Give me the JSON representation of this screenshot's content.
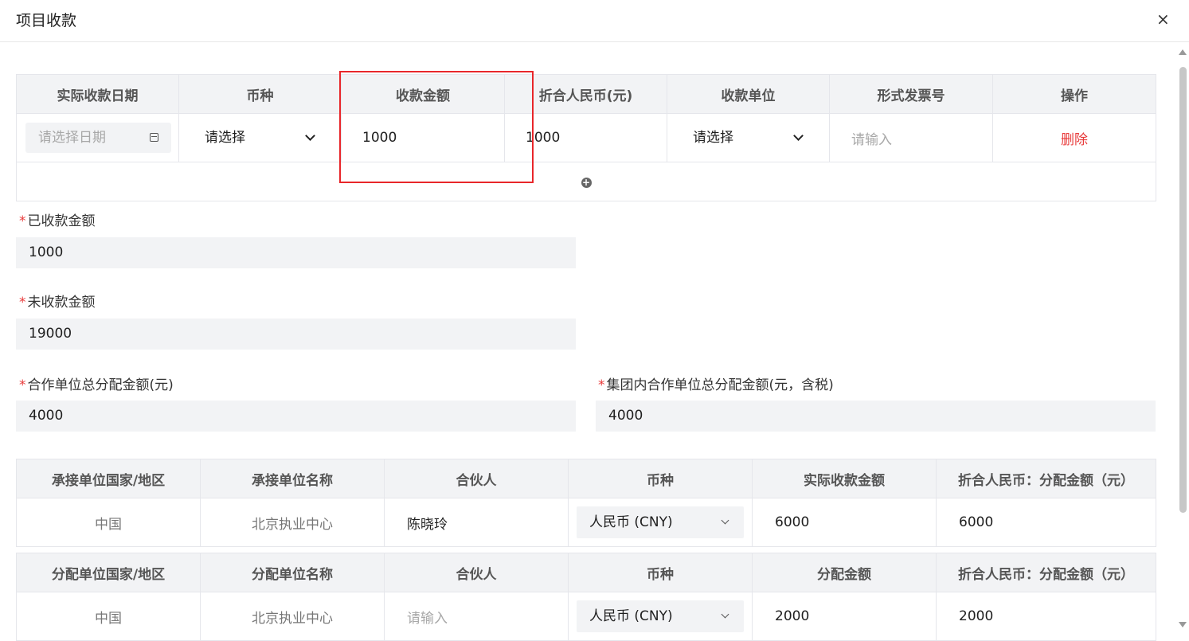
{
  "dialog": {
    "title": "项目收款",
    "close_icon": "×"
  },
  "receipts_table": {
    "headers": [
      "实际收款日期",
      "币种",
      "收款金额",
      "折合人民币(元)",
      "收款单位",
      "形式发票号",
      "操作"
    ],
    "row": {
      "date_placeholder": "请选择日期",
      "currency": "请选择",
      "amount": "1000",
      "rmb_amount": "1000",
      "receiving_unit": "请选择",
      "invoice_placeholder": "请输入",
      "delete_label": "删除"
    },
    "add_icon": "+"
  },
  "fields": {
    "received_label": "已收款金额",
    "received_value": "1000",
    "unreceived_label": "未收款金额",
    "unreceived_value": "19000",
    "partner_total_label": "合作单位总分配金额(元)",
    "partner_total_value": "4000",
    "group_total_label": "集团内合作单位总分配金额(元，含税)",
    "group_total_value": "4000"
  },
  "undertaking_table": {
    "headers": [
      "承接单位国家/地区",
      "承接单位名称",
      "合伙人",
      "币种",
      "实际收款金额",
      "折合人民币：分配金额（元）"
    ],
    "row": {
      "country": "中国",
      "name": "北京执业中心",
      "partner": "陈晓玲",
      "currency": "人民币 (CNY)",
      "amount": "6000",
      "rmb_amount": "6000"
    }
  },
  "allocation_table": {
    "headers": [
      "分配单位国家/地区",
      "分配单位名称",
      "合伙人",
      "币种",
      "分配金额",
      "折合人民币：分配金额（元）"
    ],
    "row": {
      "country": "中国",
      "name": "北京执业中心",
      "partner_placeholder": "请输入",
      "currency": "人民币 (CNY)",
      "amount": "2000",
      "rmb_amount": "2000"
    }
  },
  "colors": {
    "required_star": "#e83a3a",
    "delete": "#e83a3a",
    "highlight": "#e8262a",
    "header_bg": "#f2f3f5"
  }
}
